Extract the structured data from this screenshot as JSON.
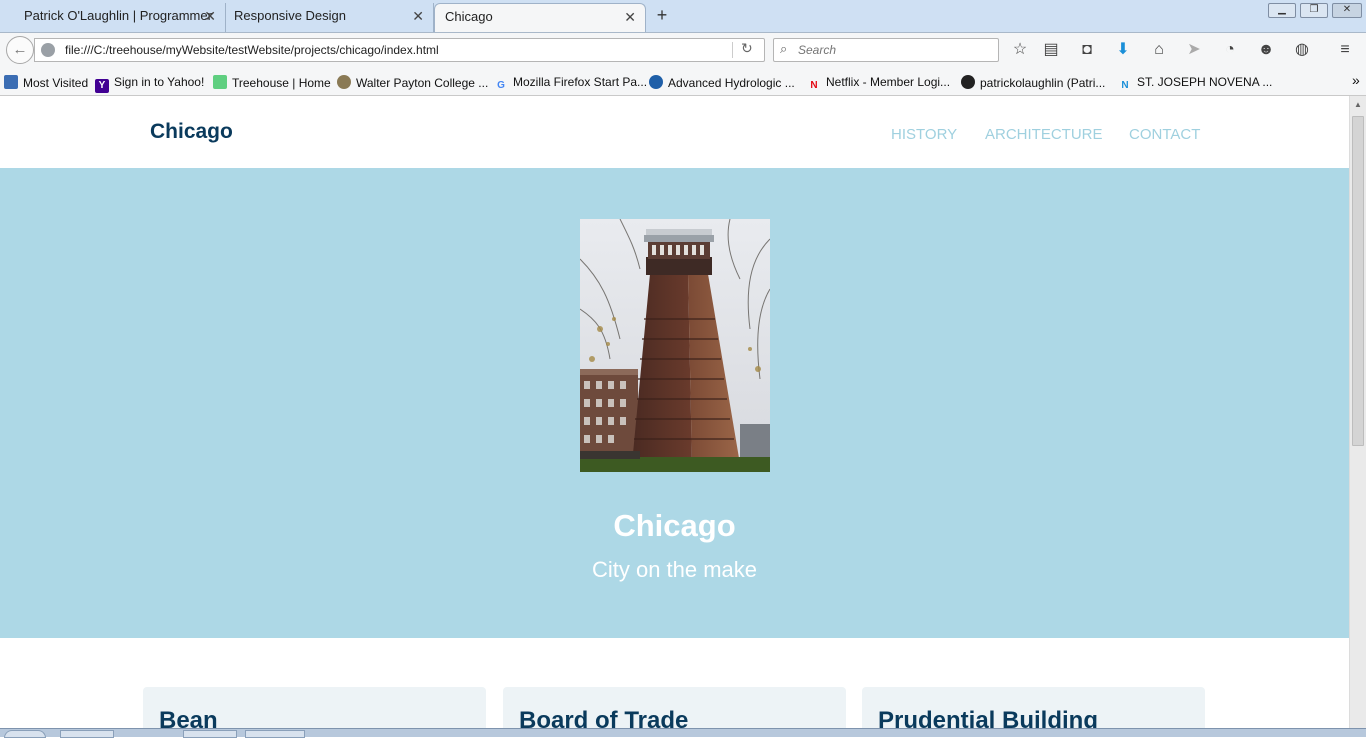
{
  "browser": {
    "tabs": [
      {
        "title": "Patrick O'Laughlin | Programmer",
        "active": false
      },
      {
        "title": "Responsive Design",
        "active": false
      },
      {
        "title": "Chicago",
        "active": true
      }
    ],
    "new_tab_symbol": "+",
    "close_symbol": "✕",
    "url": "file:///C:/treehouse/myWebsite/testWebsite/projects/chicago/index.html",
    "search_placeholder": "Search",
    "bookmarks": [
      {
        "label": "Most Visited",
        "icon": "most-visited-icon",
        "color": "#3b6db3"
      },
      {
        "label": "Sign in to Yahoo!",
        "icon": "yahoo-icon",
        "color": "#410093",
        "glyph": "Y"
      },
      {
        "label": "Treehouse | Home",
        "icon": "treehouse-icon",
        "color": "#5fcf80"
      },
      {
        "label": "Walter Payton College ...",
        "icon": "walter-payton-icon",
        "color": "#8a7a55"
      },
      {
        "label": "Mozilla Firefox Start Pa...",
        "icon": "google-icon",
        "color": "#4285f4",
        "glyph": "G"
      },
      {
        "label": "Advanced Hydrologic ...",
        "icon": "noaa-icon",
        "color": "#1f5fa8"
      },
      {
        "label": "Netflix - Member Logi...",
        "icon": "netflix-icon",
        "color": "#e50914",
        "glyph": "N"
      },
      {
        "label": "patrickolaughlin (Patri...",
        "icon": "github-icon",
        "color": "#222222"
      },
      {
        "label": "ST. JOSEPH NOVENA ...",
        "icon": "n-icon",
        "color": "#1b8fd8",
        "glyph": "N"
      }
    ],
    "overflow_symbol": "»"
  },
  "site": {
    "brand": "Chicago",
    "nav": [
      "HISTORY",
      "ARCHITECTURE",
      "CONTACT"
    ],
    "hero": {
      "title": "Chicago",
      "subtitle": "City on the make",
      "background": "#add8e6"
    },
    "cards": [
      "Bean",
      "Board of Trade",
      "Prudential Building"
    ]
  },
  "colors": {
    "brand_text": "#0a3a5c",
    "nav_text": "#9fd0df",
    "card_bg": "#edf3f6"
  }
}
